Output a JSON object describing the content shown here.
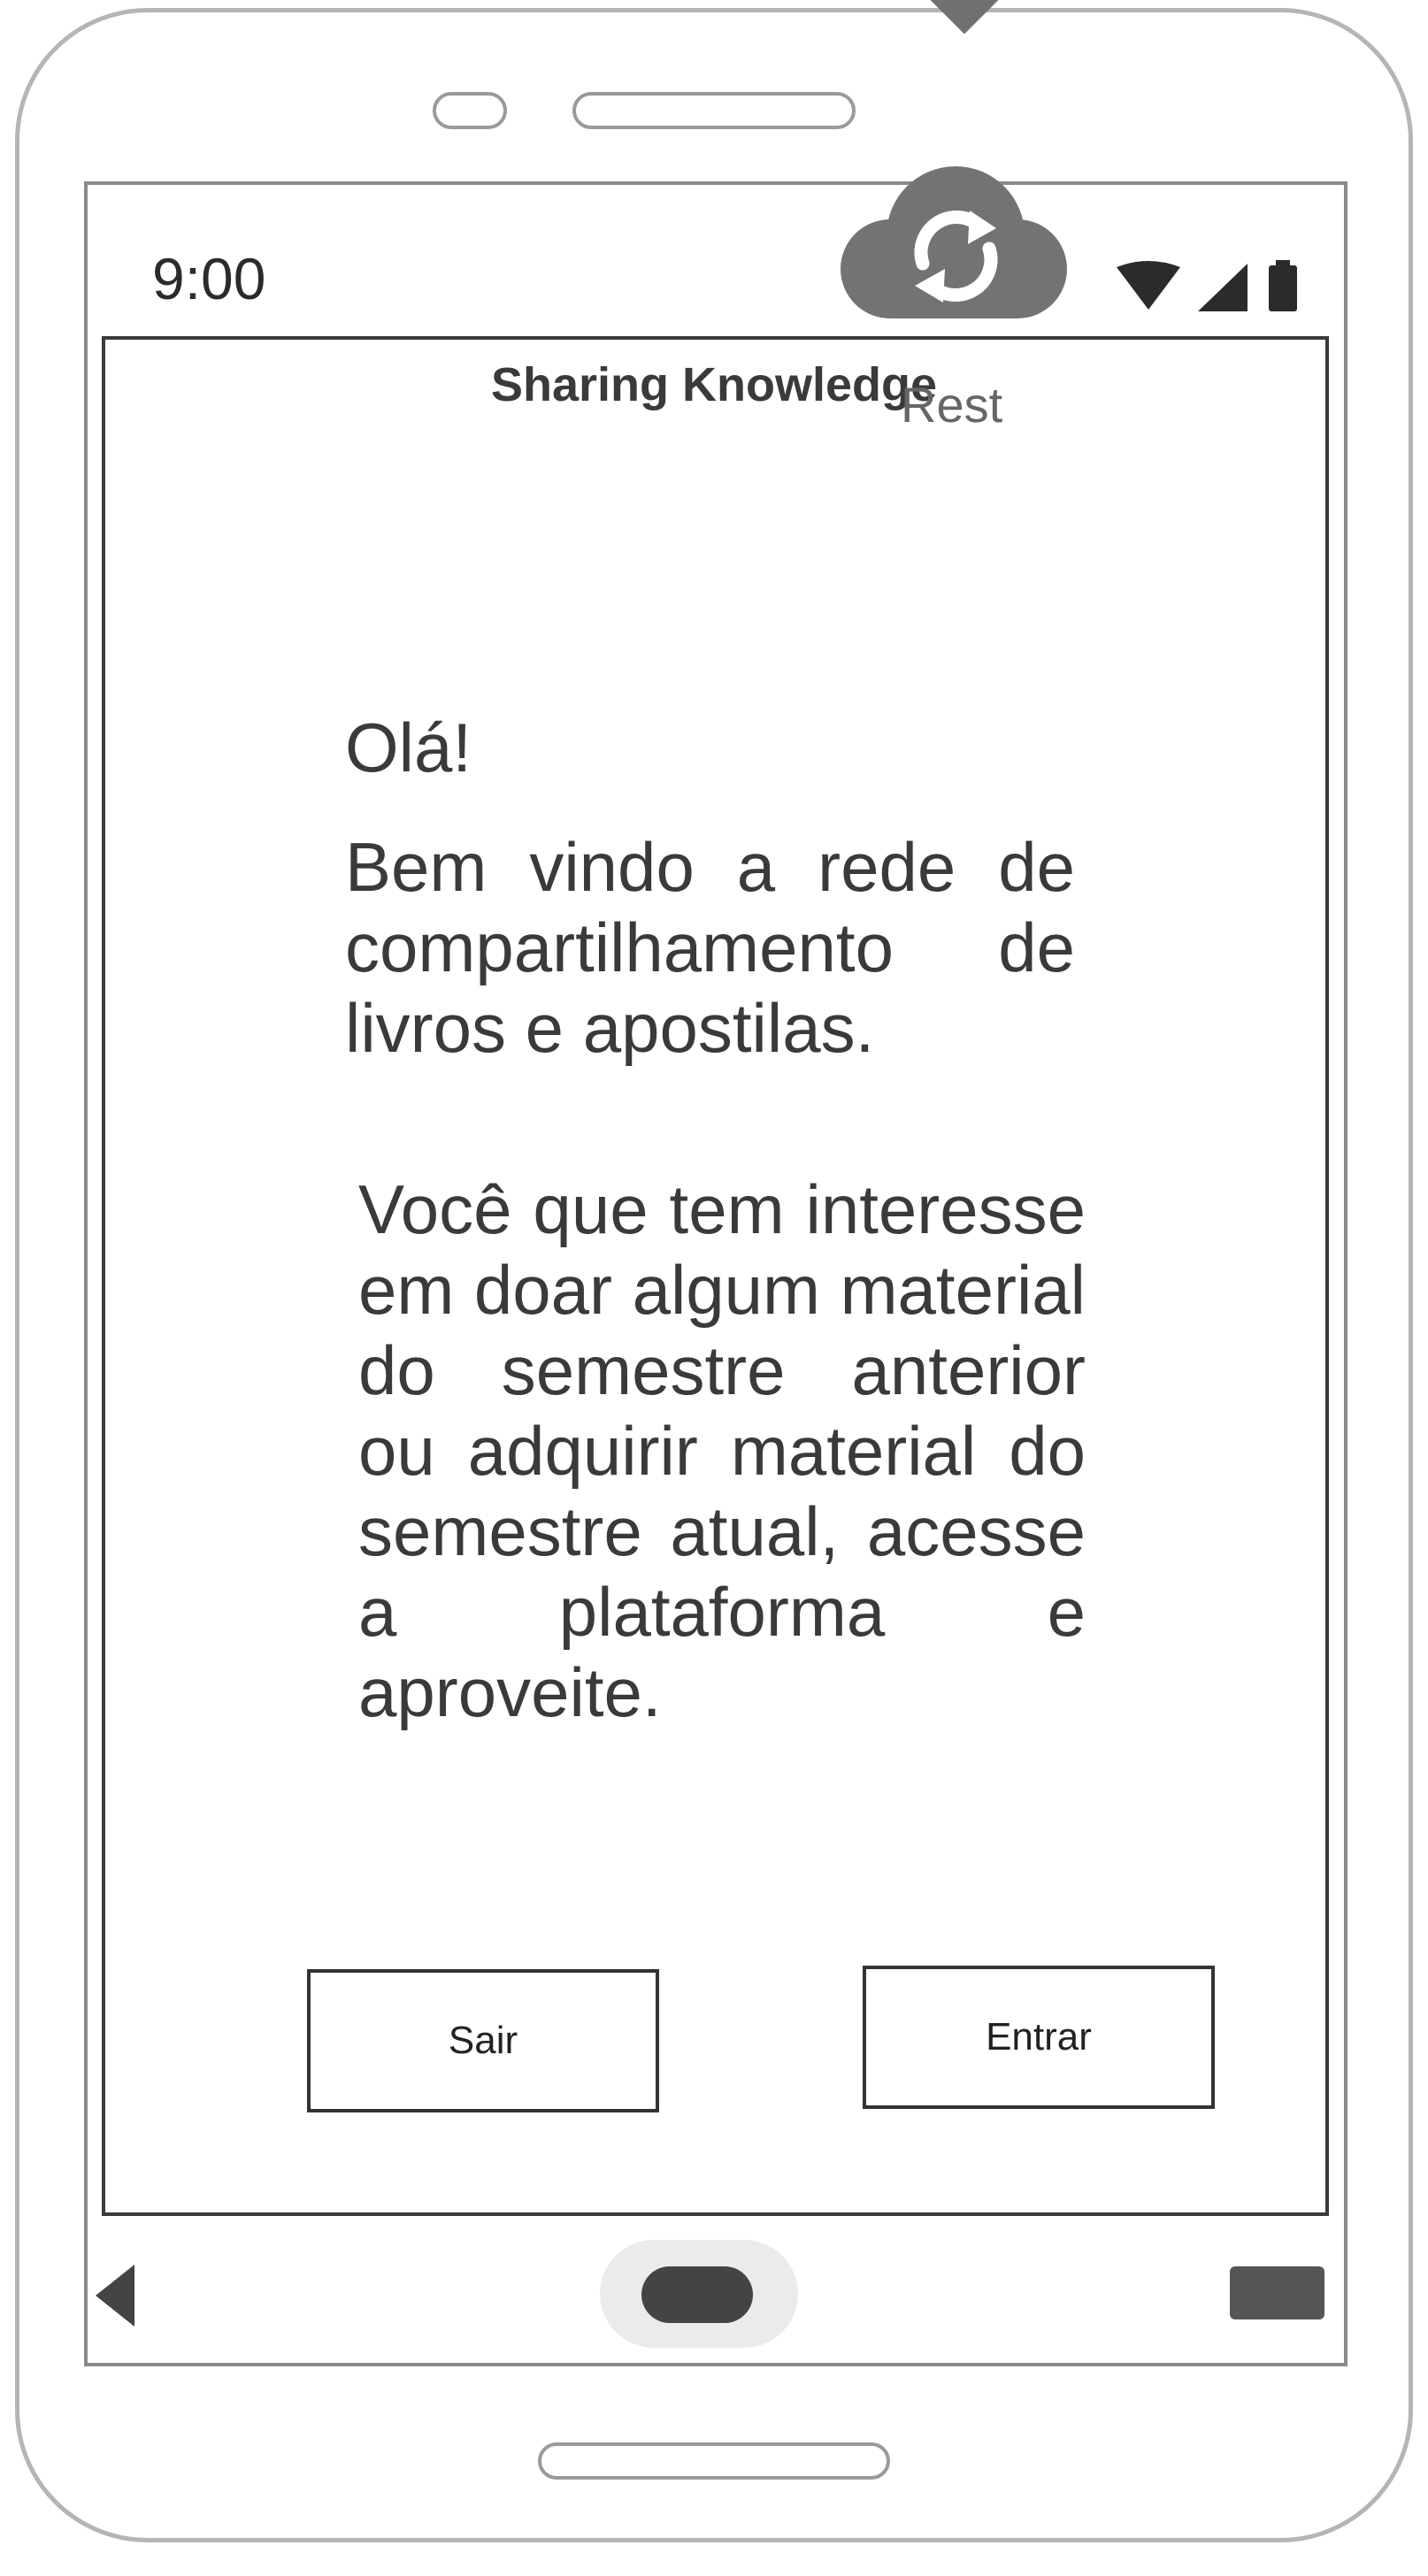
{
  "status_bar": {
    "time": "9:00"
  },
  "app": {
    "title": "Sharing Knowledge",
    "sync_label": "Rest"
  },
  "content": {
    "greeting": "Olá!",
    "welcome": "Bem vindo a rede de compartilhamento de livros e apostilas.",
    "description": "Você que tem interesse em doar algum material do semestre anterior ou adquirir material do semestre atual, acesse a plataforma e aproveite."
  },
  "buttons": {
    "exit_label": "Sair",
    "enter_label": "Entrar"
  },
  "icons": {
    "cloud": "cloud-sync-icon",
    "wifi": "wifi-icon",
    "signal": "cellular-signal-icon",
    "battery": "battery-icon",
    "back": "nav-back-icon",
    "home": "nav-home-icon",
    "recent": "nav-recent-apps-icon"
  },
  "colors": {
    "frame_gray": "#b5b5b5",
    "icon_gray": "#707070",
    "text": "#3a3a3a"
  }
}
